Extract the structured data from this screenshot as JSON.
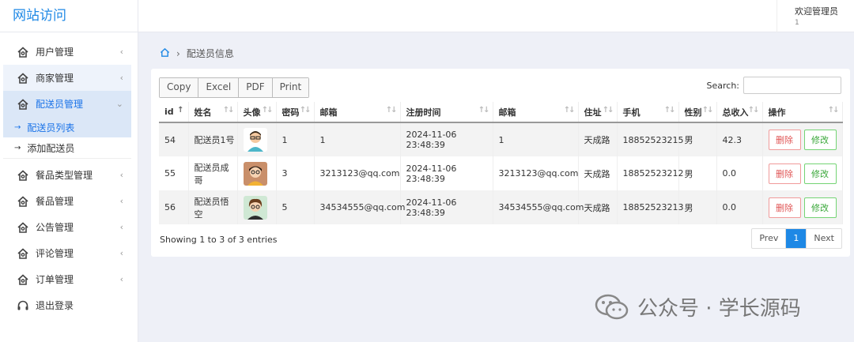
{
  "brand": "网站访问",
  "user": {
    "name": "欢迎管理员",
    "id": "1"
  },
  "menu": [
    {
      "label": "用户管理",
      "arrow": "‹"
    },
    {
      "label": "商家管理",
      "arrow": "‹"
    },
    {
      "label": "配送员管理",
      "arrow": "⌄"
    },
    {
      "label": "餐品类型管理",
      "arrow": "‹"
    },
    {
      "label": "餐品管理",
      "arrow": "‹"
    },
    {
      "label": "公告管理",
      "arrow": "‹"
    },
    {
      "label": "评论管理",
      "arrow": "‹"
    },
    {
      "label": "订单管理",
      "arrow": "‹"
    },
    {
      "label": "退出登录",
      "arrow": ""
    }
  ],
  "submenu": [
    {
      "label": "配送员列表",
      "dot": "→"
    },
    {
      "label": "添加配送员",
      "dot": "→"
    }
  ],
  "breadcrumb": {
    "current": "配送员信息"
  },
  "export_buttons": [
    "Copy",
    "Excel",
    "PDF",
    "Print"
  ],
  "search": {
    "label": "Search:",
    "value": ""
  },
  "table": {
    "headers": [
      "id",
      "姓名",
      "头像",
      "密码",
      "邮箱",
      "注册时间",
      "邮箱",
      "住址",
      "手机",
      "性别",
      "总收入",
      "操作"
    ],
    "rows": [
      {
        "id": "54",
        "name": "配送员1号",
        "avatar": "avatar-1",
        "password": "1",
        "email": "1",
        "reg_time": "2024-11-06 23:48:39",
        "email2": "1",
        "address": "天成路",
        "phone": "18852523215",
        "gender": "男",
        "income": "42.3"
      },
      {
        "id": "55",
        "name": "配送员成哥",
        "avatar": "avatar-2",
        "password": "3",
        "email": "3213123@qq.com",
        "reg_time": "2024-11-06 23:48:39",
        "email2": "3213123@qq.com",
        "address": "天成路",
        "phone": "18852523212",
        "gender": "男",
        "income": "0.0"
      },
      {
        "id": "56",
        "name": "配送员悟空",
        "avatar": "avatar-3",
        "password": "5",
        "email": "34534555@qq.com",
        "reg_time": "2024-11-06 23:48:39",
        "email2": "34534555@qq.com",
        "address": "天成路",
        "phone": "18852523213",
        "gender": "男",
        "income": "0.0"
      }
    ],
    "delete_label": "删除",
    "edit_label": "修改"
  },
  "footer": {
    "info": "Showing 1 to 3 of 3 entries",
    "prev": "Prev",
    "page": "1",
    "next": "Next"
  },
  "watermark": "公众号 · 学长源码",
  "colors": {
    "accent": "#1e88e5",
    "danger": "#e05555",
    "success": "#3aa83a",
    "background": "#eef0f7"
  }
}
